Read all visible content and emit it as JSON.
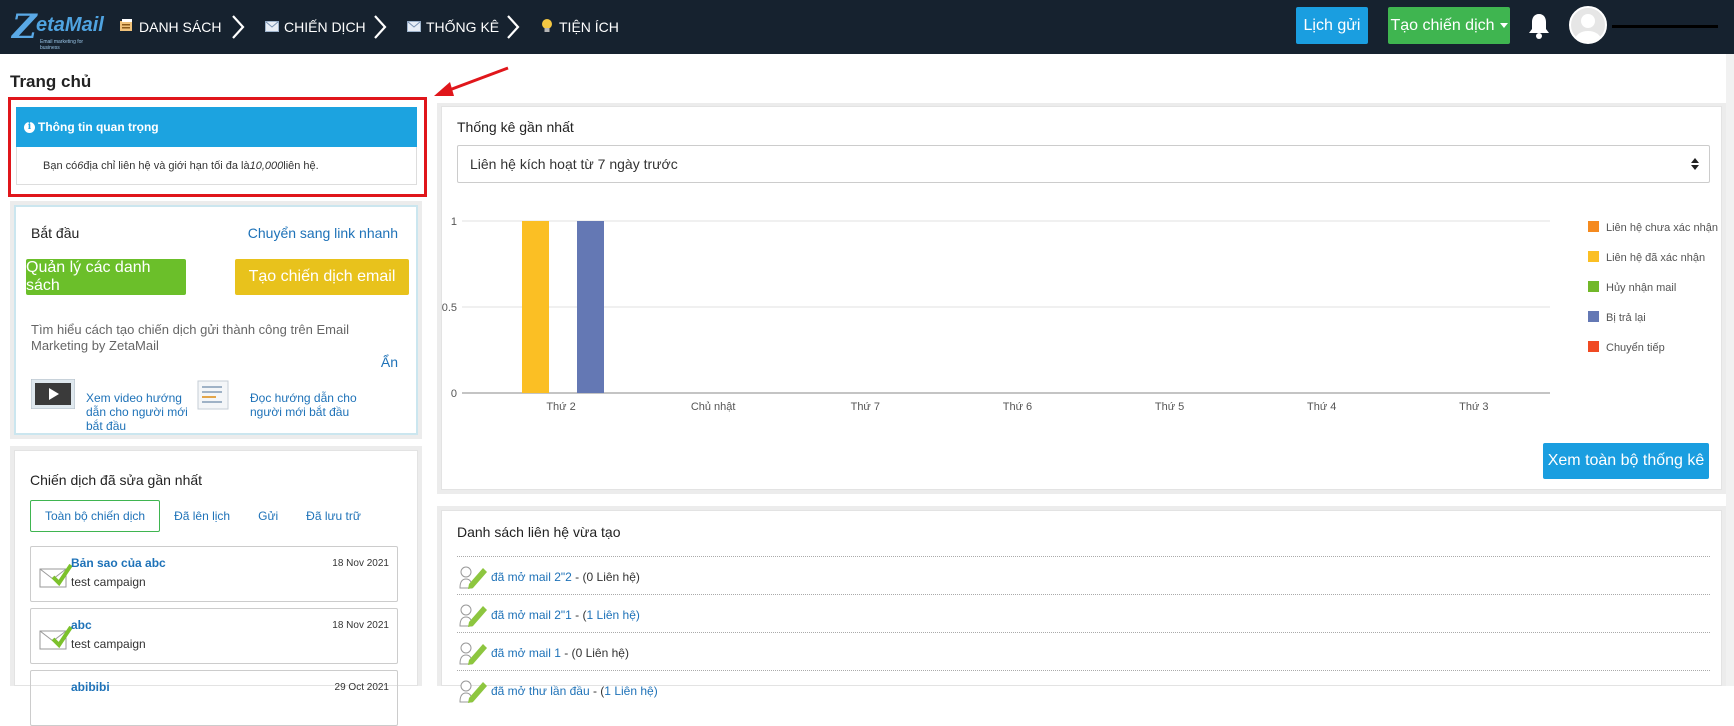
{
  "nav": {
    "logo_text": "etaMail",
    "logo_sub": "Email marketing for business",
    "items": [
      {
        "label": "DANH SÁCH",
        "icon": "list-icon"
      },
      {
        "label": "CHIẾN DỊCH",
        "icon": "envelope-icon"
      },
      {
        "label": "THỐNG KÊ",
        "icon": "envelope-icon"
      },
      {
        "label": "TIỆN ÍCH",
        "icon": "lightbulb-icon"
      }
    ],
    "lich_gui": "Lịch gửi",
    "tao_chien_dich": "Tạo chiến dịch"
  },
  "page_title": "Trang chủ",
  "info": {
    "header": "Thông tin quan trọng",
    "body_prefix": "Bạn có ",
    "contacts": "6",
    "body_mid": " địa chỉ liên hệ và giới hạn tối đa là ",
    "limit": "10,000",
    "body_suffix": " liên hệ."
  },
  "start": {
    "title": "Bắt đầu",
    "quick_link": "Chuyển sang link nhanh",
    "manage_lists": "Quản lý các danh sách",
    "create_campaign": "Tạo chiến dịch email",
    "learn": "Tìm hiểu cách tạo chiến dịch gửi thành công trên Email Marketing by ZetaMail",
    "hide": "Ẩn",
    "video_link": "Xem video hướng dẫn cho người mới bắt đầu",
    "doc_link": "Đọc hướng dẫn cho người mới bắt đầu"
  },
  "campaigns": {
    "title": "Chiến dịch đã sửa gần nhất",
    "tabs": [
      "Toàn bộ chiến dịch",
      "Đã lên lịch",
      "Gửi",
      "Đã lưu trữ"
    ],
    "items": [
      {
        "name": "Bản sao của abc",
        "sub": "test campaign",
        "date": "18 Nov 2021"
      },
      {
        "name": "abc",
        "sub": "test campaign",
        "date": "18 Nov 2021"
      },
      {
        "name": "abibibi",
        "sub": "",
        "date": "29 Oct 2021"
      }
    ]
  },
  "stats": {
    "title": "Thống kê gần nhất",
    "select_value": "Liên hệ kích hoạt từ 7 ngày trước",
    "view_all": "Xem toàn bộ thống kê"
  },
  "chart_data": {
    "type": "bar",
    "categories": [
      "Thứ 2",
      "Chủ nhật",
      "Thứ 7",
      "Thứ 6",
      "Thứ 5",
      "Thứ 4",
      "Thứ 3"
    ],
    "y_ticks": [
      "0",
      "0.5",
      "1"
    ],
    "ylim": [
      0,
      1
    ],
    "series": [
      {
        "name": "Liên hệ chưa xác nhận",
        "color": "#f58a1f",
        "values": [
          0,
          0,
          0,
          0,
          0,
          0,
          0
        ]
      },
      {
        "name": "Liên hệ đã xác nhận",
        "color": "#fbbf24",
        "values": [
          1,
          0,
          0,
          0,
          0,
          0,
          0
        ]
      },
      {
        "name": "Hủy nhận mail",
        "color": "#72b82a",
        "values": [
          0,
          0,
          0,
          0,
          0,
          0,
          0
        ]
      },
      {
        "name": "Bị trả lại",
        "color": "#6478b4",
        "values": [
          1,
          0,
          0,
          0,
          0,
          0,
          0
        ]
      },
      {
        "name": "Chuyển tiếp",
        "color": "#f04a23",
        "values": [
          0,
          0,
          0,
          0,
          0,
          0,
          0
        ]
      }
    ],
    "legend_position": "right",
    "grid": true
  },
  "contacts": {
    "title": "Danh sách liên hệ vừa tạo",
    "items": [
      {
        "name": "đã mở mail 2\"2",
        "sep": " - (",
        "count": "0",
        "suffix": " Liên hệ)"
      },
      {
        "name": "đã mở mail 2\"1",
        "sep": " - (",
        "count": "1",
        "suffix": " Liên hệ)"
      },
      {
        "name": "đã mở mail 1",
        "sep": " - (",
        "count": "0",
        "suffix": " Liên hệ)"
      },
      {
        "name": "đã mở thư lần đầu",
        "sep": " - (",
        "count": "1",
        "suffix": " Liên hệ)"
      }
    ]
  }
}
